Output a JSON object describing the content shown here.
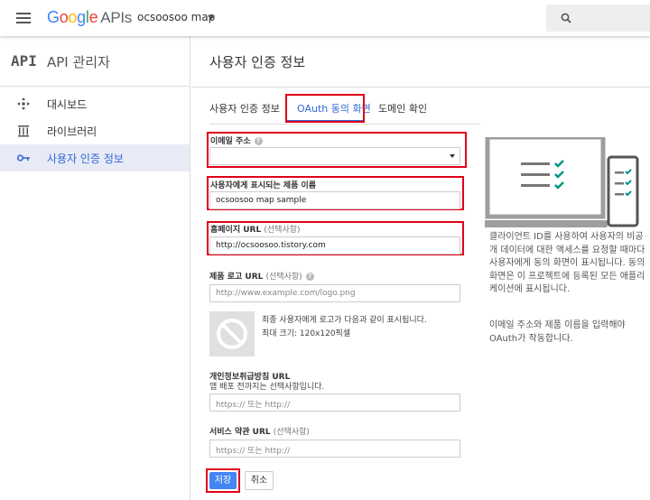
{
  "header": {
    "logo_google": "Google",
    "logo_apis": "APIs",
    "project": "ocsoosoo map"
  },
  "sidebar": {
    "logo": "API",
    "title": "API 관리자",
    "items": [
      {
        "label": "대시보드",
        "icon": "dashboard-icon"
      },
      {
        "label": "라이브러리",
        "icon": "library-icon"
      },
      {
        "label": "사용자 인증 정보",
        "icon": "key-icon",
        "active": true
      }
    ]
  },
  "main": {
    "title": "사용자 인증 정보",
    "tabs": [
      {
        "label": "사용자 인증 정보"
      },
      {
        "label": "OAuth 동의 화면",
        "active": true
      },
      {
        "label": "도메인 확인"
      }
    ],
    "email": {
      "label": "이메일 주소",
      "value": ""
    },
    "product_name": {
      "label": "사용자에게 표시되는 제품 이름",
      "value": "ocsoosoo map sample"
    },
    "homepage": {
      "label": "홈페이지 URL",
      "optional": "(선택사항)",
      "value": "http://ocsoosoo.tistory.com"
    },
    "product_logo": {
      "label": "제품 로고 URL",
      "optional": "(선택사항)",
      "placeholder": "http://www.example.com/logo.png",
      "note1": "최종 사용자에게 로고가 다음과 같이 표시됩니다.",
      "note2": "최대 크기: 120x120픽셀"
    },
    "privacy": {
      "label": "개인정보취급방침 URL",
      "sub": "앱 배포 전까지는 선택사항입니다.",
      "placeholder": "https:// 또는 http://"
    },
    "terms": {
      "label": "서비스 약관 URL",
      "optional": "(선택사항)",
      "placeholder": "https:// 또는 http://"
    },
    "save_label": "저장",
    "cancel_label": "취소"
  },
  "side_panel": {
    "paragraph1": "클라이언트 ID를 사용하여 사용자의 비공개 데이터에 대한 액세스를 요청할 때마다 사용자에게 동의 화면이 표시됩니다. 동의 화면은 이 프로젝트에 등록된 모든 애플리케이션에 표시됩니다.",
    "paragraph2": "이메일 주소와 제품 이름을 입력해야 OAuth가 작동합니다.",
    "check_color": "#009688"
  },
  "colors": {
    "accent": "#3367d6",
    "highlight": "#e0001a",
    "primary_button": "#4285f4"
  }
}
